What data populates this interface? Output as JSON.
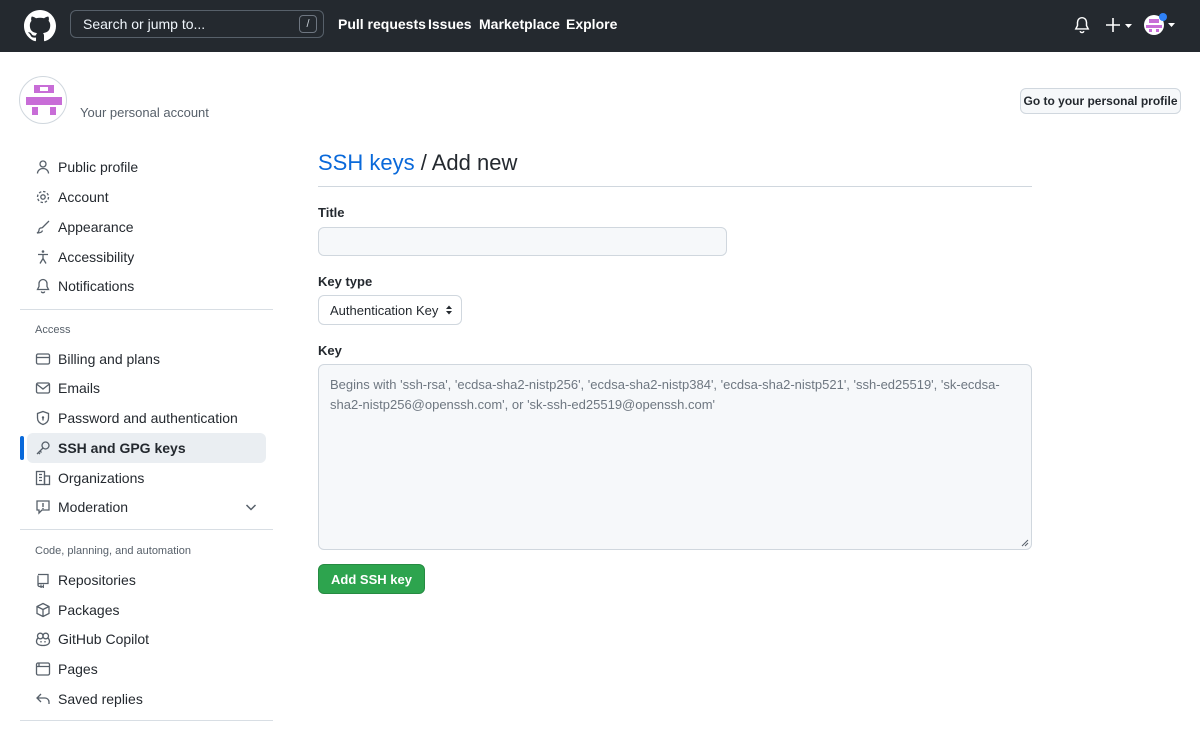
{
  "header": {
    "search_placeholder": "Search or jump to...",
    "search_shortcut": "/",
    "nav": [
      "Pull requests",
      "Issues",
      "Marketplace",
      "Explore"
    ]
  },
  "account": {
    "label": "Your personal account",
    "profile_button": "Go to your personal profile"
  },
  "sidebar": {
    "items_top": [
      {
        "label": "Public profile",
        "icon": "person-icon"
      },
      {
        "label": "Account",
        "icon": "gear-icon"
      },
      {
        "label": "Appearance",
        "icon": "paintbrush-icon"
      },
      {
        "label": "Accessibility",
        "icon": "accessibility-icon"
      },
      {
        "label": "Notifications",
        "icon": "bell-icon"
      }
    ],
    "access_heading": "Access",
    "items_access": [
      {
        "label": "Billing and plans",
        "icon": "credit-card-icon"
      },
      {
        "label": "Emails",
        "icon": "mail-icon"
      },
      {
        "label": "Password and authentication",
        "icon": "shield-lock-icon"
      },
      {
        "label": "SSH and GPG keys",
        "icon": "key-icon"
      },
      {
        "label": "Organizations",
        "icon": "organization-icon"
      },
      {
        "label": "Moderation",
        "icon": "report-icon"
      }
    ],
    "code_heading": "Code, planning, and automation",
    "items_code": [
      {
        "label": "Repositories",
        "icon": "repo-icon"
      },
      {
        "label": "Packages",
        "icon": "package-icon"
      },
      {
        "label": "GitHub Copilot",
        "icon": "copilot-icon"
      },
      {
        "label": "Pages",
        "icon": "browser-icon"
      },
      {
        "label": "Saved replies",
        "icon": "reply-icon"
      }
    ]
  },
  "main": {
    "breadcrumb_link": "SSH keys",
    "breadcrumb_sep": "/",
    "breadcrumb_current": "Add new",
    "title_label": "Title",
    "title_value": "",
    "key_type_label": "Key type",
    "key_type_value": "Authentication Key",
    "key_label": "Key",
    "key_placeholder": "Begins with 'ssh-rsa', 'ecdsa-sha2-nistp256', 'ecdsa-sha2-nistp384', 'ecdsa-sha2-nistp521', 'ssh-ed25519', 'sk-ecdsa-sha2-nistp256@openssh.com', or 'sk-ssh-ed25519@openssh.com'",
    "submit_label": "Add SSH key"
  },
  "colors": {
    "header_bg": "#24292f",
    "link": "#0969da",
    "primary_button": "#2da44e",
    "active_indicator": "#0969da"
  }
}
